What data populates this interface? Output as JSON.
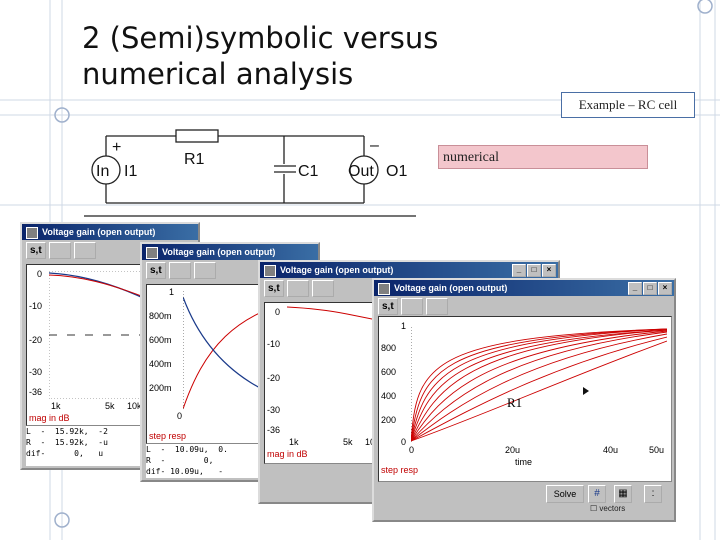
{
  "slide": {
    "title_line1": "2 (Semi)symbolic versus",
    "title_line2": "numerical analysis",
    "example_label": "Example – RC cell",
    "numerical_label": "numerical"
  },
  "circuit": {
    "plus": "+",
    "minus": "–",
    "in_label": "In",
    "i1_label": "I1",
    "r1_label": "R1",
    "c1_label": "C1",
    "out_label": "Out",
    "o1_label": "O1"
  },
  "windows": [
    {
      "title": "Voltage gain (open output)",
      "toolbar_st": "s,t",
      "yticks": [
        "0",
        "-10",
        "-20",
        "-30",
        "-36"
      ],
      "xticks": [
        "1k",
        "5k",
        "10k"
      ],
      "axis_caption": "mag in dB",
      "readout": [
        "L  -  15.92k,  -2",
        "R  -  15.92k,  -u",
        "dif-      0,   u"
      ]
    },
    {
      "title": "Voltage gain (open output)",
      "toolbar_st": "s,t",
      "yticks": [
        "1",
        "800m",
        "600m",
        "400m",
        "200m",
        "0"
      ],
      "axis_caption": "step resp",
      "readout": [
        "L  -  10.09u,  0.",
        "R  -        0,",
        "dif- 10.09u,   -"
      ]
    },
    {
      "title": "Voltage gain (open output)",
      "toolbar_st": "s,t",
      "yticks": [
        "0",
        "-10",
        "-20",
        "-30",
        "-36"
      ],
      "xticks": [
        "1k",
        "5k",
        "10"
      ],
      "axis_caption": "mag in dB"
    },
    {
      "title": "Voltage gain (open output)",
      "toolbar_st": "s,t",
      "yticks": [
        "1",
        "800",
        "600",
        "400",
        "200",
        "0"
      ],
      "xticks": [
        "0",
        "20u",
        "40u",
        "50u"
      ],
      "xlabel": "time",
      "axis_caption": "step resp",
      "param_label": "R1",
      "solve_label": "Solve",
      "vector_label": "vectors"
    }
  ],
  "colors": {
    "titlebar": "#0a246a",
    "curve_red": "#cc0000",
    "curve_blue": "#1a3a8a",
    "numerical_bg": "#f3c6cc"
  }
}
